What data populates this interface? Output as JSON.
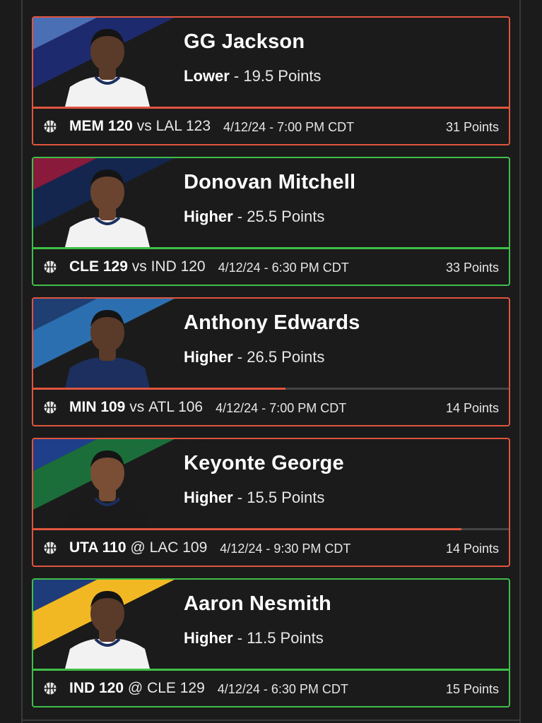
{
  "picks": [
    {
      "player": "GG Jackson",
      "direction": "Lower",
      "line": "19.5 Points",
      "team": "MEM 120",
      "separator": "vs",
      "opponent": "LAL 123",
      "datetime": "4/12/24 - 7:00 PM CDT",
      "actual": "31 Points",
      "result": "loss",
      "progress": 1.0,
      "banner_colors": [
        "#4a6fb5",
        "#1e2a6e"
      ],
      "jersey_color": "#f2f2f2",
      "skin_color": "#5a3a28"
    },
    {
      "player": "Donovan Mitchell",
      "direction": "Higher",
      "line": "25.5 Points",
      "team": "CLE 129",
      "separator": "vs",
      "opponent": "IND 120",
      "datetime": "4/12/24 - 6:30 PM CDT",
      "actual": "33 Points",
      "result": "win",
      "progress": 1.0,
      "banner_colors": [
        "#8a1a3c",
        "#14264e"
      ],
      "jersey_color": "#f2f2f2",
      "skin_color": "#6b4430"
    },
    {
      "player": "Anthony Edwards",
      "direction": "Higher",
      "line": "26.5 Points",
      "team": "MIN 109",
      "separator": "vs",
      "opponent": "ATL 106",
      "datetime": "4/12/24 - 7:00 PM CDT",
      "actual": "14 Points",
      "result": "loss",
      "progress": 0.53,
      "banner_colors": [
        "#1f3f73",
        "#2b6fb0"
      ],
      "jersey_color": "#1c2f5e",
      "skin_color": "#5a3a28"
    },
    {
      "player": "Keyonte George",
      "direction": "Higher",
      "line": "15.5 Points",
      "team": "UTA 110",
      "separator": "@",
      "opponent": "LAC 109",
      "datetime": "4/12/24 - 9:30 PM CDT",
      "actual": "14 Points",
      "result": "loss",
      "progress": 0.9,
      "banner_colors": [
        "#1f3f8a",
        "#1b6e3a"
      ],
      "jersey_color": "#1a1a1a",
      "skin_color": "#7a4e34"
    },
    {
      "player": "Aaron Nesmith",
      "direction": "Higher",
      "line": "11.5 Points",
      "team": "IND 120",
      "separator": "@",
      "opponent": "CLE 129",
      "datetime": "4/12/24 - 6:30 PM CDT",
      "actual": "15 Points",
      "result": "win",
      "progress": 1.0,
      "banner_colors": [
        "#1e3c7a",
        "#f2b824"
      ],
      "jersey_color": "#f2f2f2",
      "skin_color": "#5a3a28"
    }
  ],
  "icons": {
    "sport": "basketball-icon"
  },
  "colors": {
    "loss": "#e0553e",
    "win": "#3fbf48",
    "background": "#1b1b1b"
  }
}
